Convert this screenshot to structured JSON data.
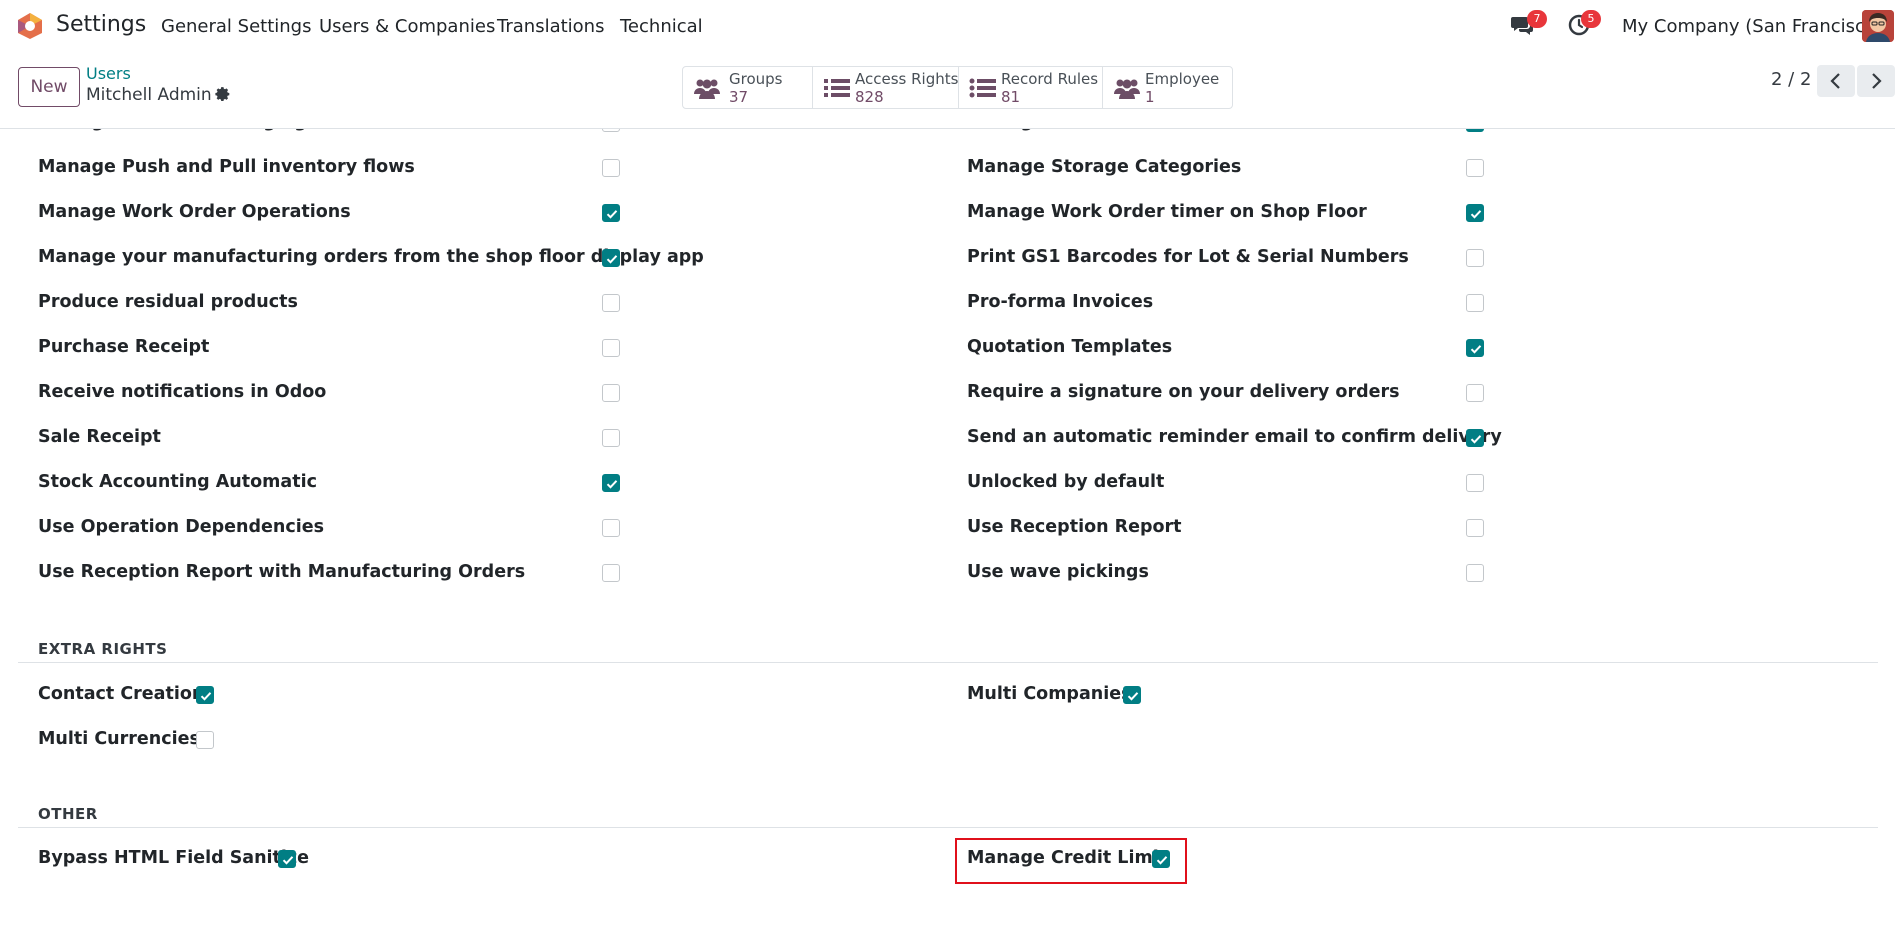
{
  "navbar": {
    "app_name": "Settings",
    "menus": [
      "General Settings",
      "Users & Companies",
      "Translations",
      "Technical"
    ],
    "messages_count": "7",
    "activities_count": "5",
    "company": "My Company (San Francisco)"
  },
  "control": {
    "new_label": "New",
    "breadcrumb_parent": "Users",
    "record_name": "Mitchell Admin",
    "smart_buttons": [
      {
        "label": "Groups",
        "value": "37",
        "icon": "users-icon"
      },
      {
        "label": "Access Rights",
        "value": "828",
        "icon": "list-icon"
      },
      {
        "label": "Record Rules",
        "value": "81",
        "icon": "list-icon"
      },
      {
        "label": "Employee",
        "value": "1",
        "icon": "users-icon"
      }
    ],
    "pager": "2 / 2"
  },
  "rights_left": [
    {
      "label": "Manage Product Packaging",
      "checked": false
    },
    {
      "label": "Manage Push and Pull inventory flows",
      "checked": false
    },
    {
      "label": "Manage Work Order Operations",
      "checked": true
    },
    {
      "label": "Manage your manufacturing orders from the shop floor display app",
      "checked": true
    },
    {
      "label": "Produce residual products",
      "checked": false
    },
    {
      "label": "Purchase Receipt",
      "checked": false
    },
    {
      "label": "Receive notifications in Odoo",
      "checked": false
    },
    {
      "label": "Sale Receipt",
      "checked": false
    },
    {
      "label": "Stock Accounting Automatic",
      "checked": true
    },
    {
      "label": "Use Operation Dependencies",
      "checked": false
    },
    {
      "label": "Use Reception Report with Manufacturing Orders",
      "checked": false
    }
  ],
  "rights_right": [
    {
      "label": "Manage Product Variants",
      "checked": true
    },
    {
      "label": "Manage Storage Categories",
      "checked": false
    },
    {
      "label": "Manage Work Order timer on Shop Floor",
      "checked": true
    },
    {
      "label": "Print GS1 Barcodes for Lot & Serial Numbers",
      "checked": false
    },
    {
      "label": "Pro-forma Invoices",
      "checked": false
    },
    {
      "label": "Quotation Templates",
      "checked": true
    },
    {
      "label": "Require a signature on your delivery orders",
      "checked": false
    },
    {
      "label": "Send an automatic reminder email to confirm delivery",
      "checked": true
    },
    {
      "label": "Unlocked by default",
      "checked": false
    },
    {
      "label": "Use Reception Report",
      "checked": false
    },
    {
      "label": "Use wave pickings",
      "checked": false
    }
  ],
  "extra_rights": {
    "title": "EXTRA RIGHTS",
    "items": [
      {
        "label": "Contact Creation",
        "checked": true
      },
      {
        "label": "Multi Companies",
        "checked": true
      },
      {
        "label": "Multi Currencies",
        "checked": false
      }
    ]
  },
  "other": {
    "title": "OTHER",
    "items": [
      {
        "label": "Bypass HTML Field Sanitize",
        "checked": true
      },
      {
        "label": "Manage Credit Limit",
        "checked": true
      }
    ]
  },
  "colors": {
    "accent": "#017e84",
    "brand": "#714b67",
    "badge": "#e8363b",
    "highlight": "#e0101b"
  }
}
